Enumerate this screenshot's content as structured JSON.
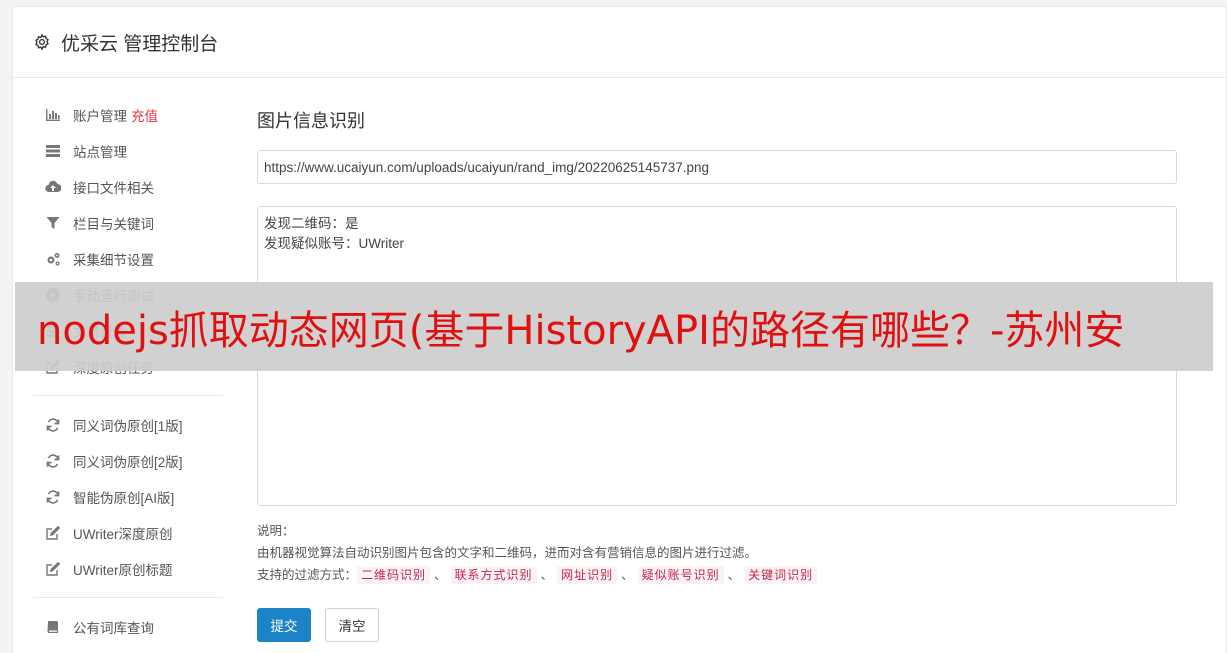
{
  "header": {
    "title": "优采云 管理控制台"
  },
  "sidebar": {
    "group1": [
      {
        "label": "账户管理",
        "extra": "充值",
        "icon": "bar-chart-icon"
      },
      {
        "label": "站点管理",
        "icon": "server-icon"
      },
      {
        "label": "接口文件相关",
        "icon": "cloud-upload-icon"
      },
      {
        "label": "栏目与关键词",
        "icon": "filter-icon"
      },
      {
        "label": "采集细节设置",
        "icon": "gears-icon"
      },
      {
        "label": "手动运行测试",
        "icon": "play-circle-icon"
      },
      {
        "label": "文章管理",
        "icon": "database-icon"
      },
      {
        "label": "深度原创任务",
        "icon": "edit-icon"
      }
    ],
    "group2": [
      {
        "label": "同义词伪原创[1版]",
        "icon": "refresh-icon"
      },
      {
        "label": "同义词伪原创[2版]",
        "icon": "refresh-icon"
      },
      {
        "label": "智能伪原创[AI版]",
        "icon": "refresh-icon"
      },
      {
        "label": "UWriter深度原创",
        "icon": "edit-icon"
      },
      {
        "label": "UWriter原创标题",
        "icon": "edit-icon"
      }
    ],
    "group3": [
      {
        "label": "公有词库查询",
        "icon": "book-icon"
      }
    ]
  },
  "main": {
    "title": "图片信息识别",
    "url_value": "https://www.ucaiyun.com/uploads/ucaiyun/rand_img/20220625145737.png",
    "result_lines": [
      "发现二维码：是",
      "发现疑似账号：UWriter"
    ],
    "desc_heading": "说明：",
    "desc_text": "由机器视觉算法自动识别图片包含的文字和二维码，进而对含有营销信息的图片进行过滤。",
    "filter_label": "支持的过滤方式：",
    "filter_tags": [
      "二维码识别",
      "联系方式识别",
      "网址识别",
      "疑似账号识别",
      "关键词识别"
    ],
    "filter_separator": "、",
    "submit_label": "提交",
    "clear_label": "清空"
  },
  "overlay": {
    "text": "nodejs抓取动态网页(基于HistoryAPI的路径有哪些？-苏州安"
  },
  "colors": {
    "primary": "#1c84c6",
    "recharge": "#e4393c",
    "overlay_text": "#e01010",
    "tag_text": "#c7254e"
  }
}
